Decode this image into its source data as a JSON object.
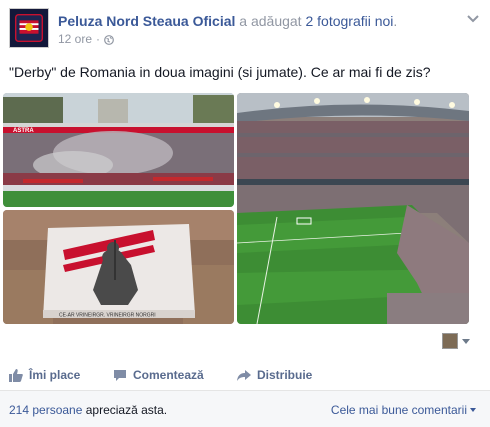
{
  "post": {
    "page_name": "Peluza Nord Steaua Oficial",
    "action_prefix": "a adăugat",
    "photos_link": "2 fotografii noi",
    "action_suffix": ".",
    "timestamp": "12 ore",
    "separator": "·",
    "privacy_icon": "globe-icon",
    "message": "\"Derby\" de Romania in doua imagini (si jumate). Ce ar mai fi de zis?"
  },
  "photos": {
    "banner_text_top": "ASTRA",
    "banner_text_mid": "ASTRA",
    "flag_text": "CE-AR VRINEIRGR. VRINEIRGR NORGRI"
  },
  "actions": {
    "like_label": "Îmi place",
    "like_icon": "thumbs-up-icon",
    "comment_label": "Comentează",
    "comment_icon": "comment-icon",
    "share_label": "Distribuie",
    "share_icon": "share-arrow-icon"
  },
  "likes": {
    "count_text": "214 persoane",
    "suffix": "apreciază asta.",
    "sort_label": "Cele mai bune comentarii"
  },
  "colors": {
    "link": "#3b5998",
    "muted": "#9197a3",
    "footer_bg": "#f6f7f9"
  }
}
